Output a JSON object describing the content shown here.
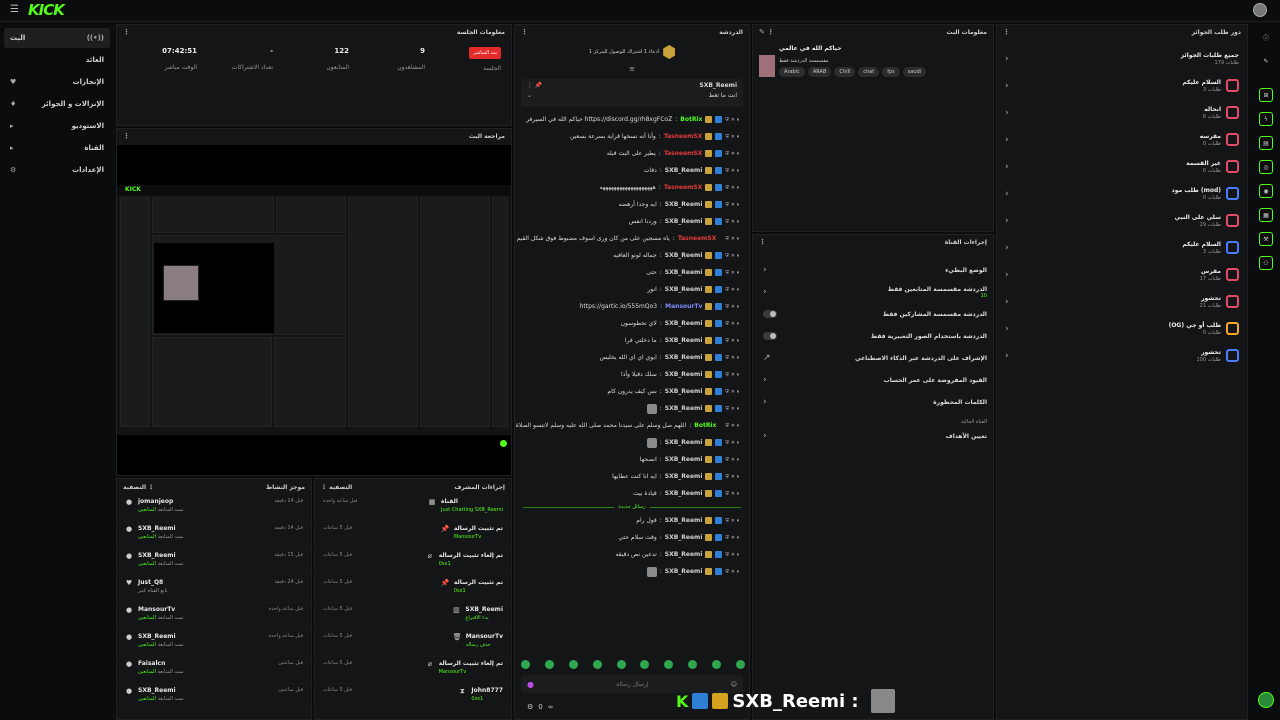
{
  "header": {
    "logo": "KICK"
  },
  "sidebar": {
    "items": [
      {
        "label": "البث",
        "icon": "((•))"
      },
      {
        "label": "العائد",
        "icon": ""
      },
      {
        "label": "الإنجازات",
        "icon": "♥"
      },
      {
        "label": "الإنزالات و الجوائز",
        "icon": "♦"
      },
      {
        "label": "الاستوديو",
        "icon": "▸"
      },
      {
        "label": "القناة",
        "icon": "▸"
      },
      {
        "label": "الإعدادات",
        "icon": "⚙"
      }
    ]
  },
  "session": {
    "title": "معلومات الجلسة",
    "stats": [
      {
        "value": "07:42:51",
        "label": "الوقت مباشر"
      },
      {
        "value": "-",
        "label": "تعداد الاشتراكات"
      },
      {
        "value": "122",
        "label": "المتابعون"
      },
      {
        "value": "9",
        "label": "المشاهدون"
      }
    ],
    "live_badge": "بث المباشر",
    "live_label": "الجلسة"
  },
  "preview": {
    "title": "مراجعة البث"
  },
  "activity": {
    "title": "موجز النشاط",
    "filter": "التصفية",
    "rows": [
      {
        "name": "jomanjeop",
        "sub": "تمت المتابعة",
        "tag": "المتابعين",
        "time": "قبل 14 دقيقة",
        "icon": "●"
      },
      {
        "name": "SXB_Reemi",
        "sub": "تمت المتابعة",
        "tag": "المتابعين",
        "time": "قبل 14 دقيقة",
        "icon": "●"
      },
      {
        "name": "SXB_Reemi",
        "sub": "تمت المتابعة",
        "tag": "المتابعين",
        "time": "قبل 15 دقيقة",
        "icon": "●"
      },
      {
        "name": "Just_Q8",
        "sub": "تابع القناة كثير",
        "tag": "",
        "time": "قبل 24 دقيقة",
        "icon": "♥"
      },
      {
        "name": "MansourTv",
        "sub": "تمت المتابعة",
        "tag": "المتابعين",
        "time": "قبل ساعة واحدة",
        "icon": "●"
      },
      {
        "name": "SXB_Reemi",
        "sub": "تمت المتابعة",
        "tag": "المتابعين",
        "time": "قبل ساعة واحدة",
        "icon": "●"
      },
      {
        "name": "Faisalcn",
        "sub": "تمت المتابعة",
        "tag": "المتابعين",
        "time": "قبل ساعتين",
        "icon": "●"
      },
      {
        "name": "SXB_Reemi",
        "sub": "تمت المتابعة",
        "tag": "المتابعين",
        "time": "قبل ساعتين",
        "icon": "●"
      }
    ]
  },
  "modactions": {
    "title": "إجراءات المشرف",
    "filter": "التصفية",
    "rows": [
      {
        "name": "القناة",
        "sub1": "Just Chatting",
        "sub2": "SXB_Reemi",
        "time": "قبل ساعة واحدة",
        "icon": "▦"
      },
      {
        "name": "تم تثبيت الرسالة",
        "sub1": "MansourTv",
        "sub2": "",
        "time": "قبل 5 ساعات",
        "icon": "📌"
      },
      {
        "name": "تم إلغاء تثبيت الرسالة",
        "sub1": "0sx1",
        "sub2": "",
        "time": "قبل 5 ساعات",
        "icon": "⌀"
      },
      {
        "name": "تم تثبيت الرسالة",
        "sub1": "0sx1",
        "sub2": "",
        "time": "قبل 5 ساعات",
        "icon": "📌"
      },
      {
        "name": "SXB_Reemi",
        "sub1": "بدء الاقتراع",
        "sub2": "",
        "time": "قبل 5 ساعات",
        "icon": "▥"
      },
      {
        "name": "MansourTv",
        "sub1": "حذف رسالة",
        "sub2": "",
        "time": "قبل 5 ساعات",
        "icon": "🗑"
      },
      {
        "name": "تم إلغاء تثبيت الرسالة",
        "sub1": "MansourTv",
        "sub2": "",
        "time": "قبل 5 ساعات",
        "icon": "⌀"
      },
      {
        "name": "John8777",
        "sub1": "0sx1",
        "sub2": "",
        "time": "قبل 5 ساعات",
        "icon": "⧗"
      }
    ]
  },
  "chat": {
    "title": "الدردشة",
    "banner": "ادعاء 1 اشتراك للوصول للمركز 1",
    "pinned_user": "SXB_Reemi",
    "pinned_text": "انت ما تغط",
    "new_divider": "رسائل جديدة",
    "input_placeholder": "إرسال رسالة",
    "footer_count": "0",
    "messages": [
      {
        "user": "BotRix",
        "color": "#53fc18",
        "text": "حياكم الله في السيرفر https://discord.gg/rh8xgFCoZ"
      },
      {
        "user": "TasneemSX",
        "color": "#e23a3a",
        "text": "وأنا أنه نسخها قراية بسرعة بسعين"
      },
      {
        "user": "TasneemSX",
        "color": "#e23a3a",
        "text": "يطير على البث قبله"
      },
      {
        "user": "SXB_Reemi",
        "color": "#cfd1d3",
        "text": "دقات"
      },
      {
        "user": "TasneemSX",
        "color": "#e23a3a",
        "text": "هههههههههههههههههههه"
      },
      {
        "user": "SXB_Reemi",
        "color": "#cfd1d3",
        "text": "ايه وجدا أرهضه"
      },
      {
        "user": "SXB_Reemi",
        "color": "#cfd1d3",
        "text": "وردنا انفس"
      },
      {
        "user": "TasneemSX",
        "color": "#e23a3a",
        "text": "ياه مسجين على من كان ورى اسوف مضبوط فوق شكل القيم طالع"
      },
      {
        "user": "SXB_Reemi",
        "color": "#cfd1d3",
        "text": "جماله لونو العافيه"
      },
      {
        "user": "SXB_Reemi",
        "color": "#cfd1d3",
        "text": "حتى"
      },
      {
        "user": "SXB_Reemi",
        "color": "#cfd1d3",
        "text": "انور"
      },
      {
        "user": "MansourTv",
        "color": "#7b8cff",
        "text": "https://gartic.io/555mQo3"
      },
      {
        "user": "SXB_Reemi",
        "color": "#cfd1d3",
        "text": "لاي تحطوسون"
      },
      {
        "user": "SXB_Reemi",
        "color": "#cfd1d3",
        "text": "ما دخلتي فرا"
      },
      {
        "user": "SXB_Reemi",
        "color": "#cfd1d3",
        "text": "ايوي اي اي الله يخليس"
      },
      {
        "user": "SXB_Reemi",
        "color": "#cfd1d3",
        "text": "سلك دقيلا وأذا"
      },
      {
        "user": "SXB_Reemi",
        "color": "#cfd1d3",
        "text": "بس كيف يدرون كام"
      },
      {
        "user": "SXB_Reemi",
        "color": "#cfd1d3",
        "text": ""
      },
      {
        "user": "BotRix",
        "color": "#53fc18",
        "text": "اللهم صل وسلم على سيدنا محمد صلى الله عليه وسلم لاتنسو الصلاة عليه"
      },
      {
        "user": "SXB_Reemi",
        "color": "#cfd1d3",
        "text": ""
      },
      {
        "user": "SXB_Reemi",
        "color": "#cfd1d3",
        "text": "انصحها"
      },
      {
        "user": "SXB_Reemi",
        "color": "#cfd1d3",
        "text": "ايه انا كنت عطايها"
      },
      {
        "user": "SXB_Reemi",
        "color": "#cfd1d3",
        "text": "قيادة بيت"
      }
    ],
    "messages_after": [
      {
        "user": "SXB_Reemi",
        "color": "#cfd1d3",
        "text": "قول رام"
      },
      {
        "user": "SXB_Reemi",
        "color": "#cfd1d3",
        "text": "وقت سلام حتي"
      },
      {
        "user": "SXB_Reemi",
        "color": "#cfd1d3",
        "text": "تدعين نص دقيقه"
      },
      {
        "user": "SXB_Reemi",
        "color": "#cfd1d3",
        "text": ""
      }
    ]
  },
  "streaminfo": {
    "title": "معلومات البث",
    "stream_title": "حياكم الله في عالمي",
    "category": "مقسمسة الدردشة فقط",
    "tags": [
      "Arabic",
      "ARAB",
      "Chill",
      "chat",
      "fps",
      "saudi"
    ]
  },
  "channelactions": {
    "title": "إجراءات القناة",
    "rows": [
      {
        "label": "الوضع البطيء",
        "sub": "",
        "control": "arrow"
      },
      {
        "label": "الدردشة مقسمسة المتابعين فقط",
        "sub": "10",
        "control": "arrow"
      },
      {
        "label": "الدردشة مقسمسة المشاركين فقط",
        "sub": "",
        "control": "toggle"
      },
      {
        "label": "الدردشة باستخدام الصور التعبيرية فقط",
        "sub": "",
        "control": "toggle"
      },
      {
        "label": "الإشراف على الدردشة عبر الذكاء الاصطناعي",
        "sub": "",
        "control": "ext"
      },
      {
        "label": "القيود المفروضة على عمر الحساب",
        "sub": "",
        "control": "arrow"
      },
      {
        "label": "الكلمات المحظورة",
        "sub": "",
        "control": "arrow"
      }
    ],
    "section": "القناة الحالية",
    "goal": "تعيين الأهداف"
  },
  "rewards": {
    "title": "دور طلب الجوائز",
    "items": [
      {
        "name": "جميع طلبات الجوائز",
        "count": "طلبات 179",
        "color": "#cfd1d3"
      },
      {
        "name": "السلام عليكم",
        "count": "طلبات 3",
        "color": "#e34b6b"
      },
      {
        "name": "انحاله",
        "count": "طلبات 6",
        "color": "#e34b6b"
      },
      {
        "name": "مقرسه",
        "count": "طلبات 0",
        "color": "#e34b6b"
      },
      {
        "name": "غير القسمة",
        "count": "طلبات 0",
        "color": "#e34b6b"
      },
      {
        "name": "طلب مود (mod)",
        "count": "طلبات 0",
        "color": "#4d7bff"
      },
      {
        "name": "سلي على النبي",
        "count": "طلبات 29",
        "color": "#e34b6b"
      },
      {
        "name": "السلام عليكم",
        "count": "طلبات 3",
        "color": "#4d7bff"
      },
      {
        "name": "مقرس",
        "count": "طلبات 17",
        "color": "#e34b6b"
      },
      {
        "name": "تحشور",
        "count": "طلبات 21",
        "color": "#e34b6b"
      },
      {
        "name": "(OG) طلب أو جي",
        "count": "طلبات 0",
        "color": "#f5a623"
      },
      {
        "name": "تحشور",
        "count": "طلبات 100",
        "color": "#4d7bff"
      }
    ]
  },
  "overlay": {
    "name": "SXB_Reemi :"
  }
}
